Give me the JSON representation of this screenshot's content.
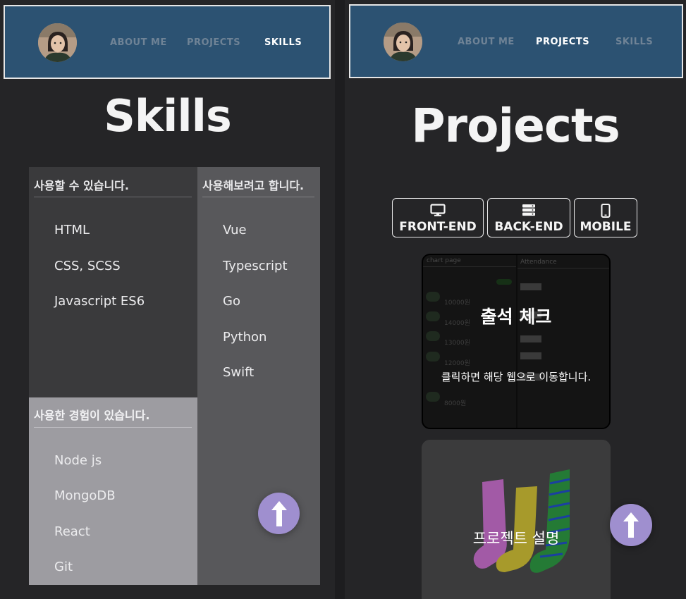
{
  "nav": {
    "about_label": "ABOUT ME",
    "projects_label": "PROJECTS",
    "skills_label": "SKILLS"
  },
  "skills_page": {
    "title": "Skills",
    "can_use": {
      "heading": "사용할 수 있습니다.",
      "items": [
        "HTML",
        "CSS, SCSS",
        "Javascript ES6"
      ]
    },
    "want_to_try": {
      "heading": "사용해보려고 합니다.",
      "items": [
        "Vue",
        "Typescript",
        "Go",
        "Python",
        "Swift"
      ]
    },
    "have_used": {
      "heading": "사용한 경험이 있습니다.",
      "items": [
        "Node js",
        "MongoDB",
        "React",
        "Git"
      ]
    }
  },
  "projects_page": {
    "title": "Projects",
    "filters": [
      {
        "label": "FRONT-END",
        "icon": "monitor-icon"
      },
      {
        "label": "BACK-END",
        "icon": "server-icon"
      },
      {
        "label": "MOBILE",
        "icon": "smartphone-icon"
      }
    ],
    "cards": [
      {
        "title": "출석 체크",
        "subtitle": "클릭하면 해당 웹으로 이동합니다.",
        "preview_left_title": "chart page",
        "preview_right_title": "Attendance",
        "preview_amounts": [
          "10000원",
          "14000원",
          "13000원",
          "12000원",
          "8000원"
        ]
      },
      {
        "title": "프로젝트 설명"
      }
    ]
  },
  "colors": {
    "background": "#252527",
    "navbar": "#2c5272",
    "scroll_button": "#9f8fcf",
    "col_can": "#3a3a3c",
    "col_try": "#58585b",
    "col_used": "#9d9ca1"
  }
}
